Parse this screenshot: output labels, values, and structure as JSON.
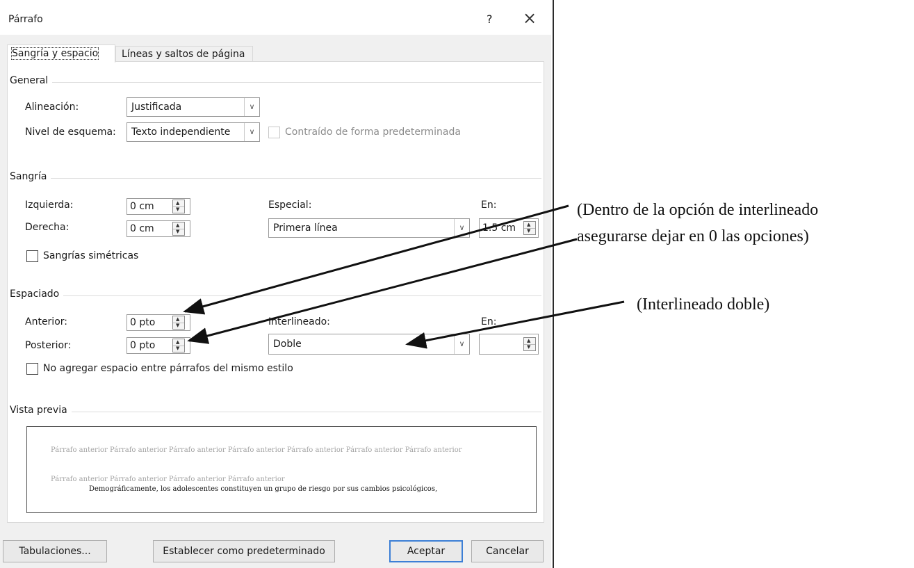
{
  "dialog": {
    "title": "Párrafo",
    "help": "?",
    "close": "×",
    "tabs": [
      "Sangría y espacio",
      "Líneas y saltos de página"
    ]
  },
  "general": {
    "legend": "General",
    "alineacion_label": "Alineación:",
    "alineacion_value": "Justificada",
    "nivel_label": "Nivel de esquema:",
    "nivel_value": "Texto independiente",
    "contraido_label": "Contraído de forma predeterminada"
  },
  "sangria": {
    "legend": "Sangría",
    "izquierda_label": "Izquierda:",
    "izquierda_value": "0 cm",
    "derecha_label": "Derecha:",
    "derecha_value": "0 cm",
    "especial_label": "Especial:",
    "especial_value": "Primera línea",
    "en_label": "En:",
    "en_value": "1.5 cm",
    "simetricas_label": "Sangrías simétricas"
  },
  "espaciado": {
    "legend": "Espaciado",
    "anterior_label": "Anterior:",
    "anterior_value": "0 pto",
    "posterior_label": "Posterior:",
    "posterior_value": "0 pto",
    "interlineado_label": "Interlineado:",
    "interlineado_value": "Doble",
    "en_label": "En:",
    "en_value": "",
    "no_agregar_label": "No agregar espacio entre párrafos del mismo estilo"
  },
  "preview": {
    "legend": "Vista previa",
    "prev_line1": "Párrafo anterior Párrafo anterior Párrafo anterior Párrafo anterior Párrafo anterior Párrafo anterior Párrafo anterior",
    "prev_line2": "Párrafo anterior Párrafo anterior Párrafo anterior Párrafo anterior",
    "sample": "Demográficamente, los adolescentes constituyen un grupo de riesgo por sus cambios psicológicos,"
  },
  "buttons": {
    "tabulaciones": "Tabulaciones...",
    "predeterminado": "Establecer como predeterminado",
    "aceptar": "Aceptar",
    "cancelar": "Cancelar"
  },
  "annotations": {
    "note1_line1": "(Dentro de la opción de interlineado",
    "note1_line2": "asegurarse dejar en 0 las opciones)",
    "note2": "(Interlineado doble)"
  }
}
